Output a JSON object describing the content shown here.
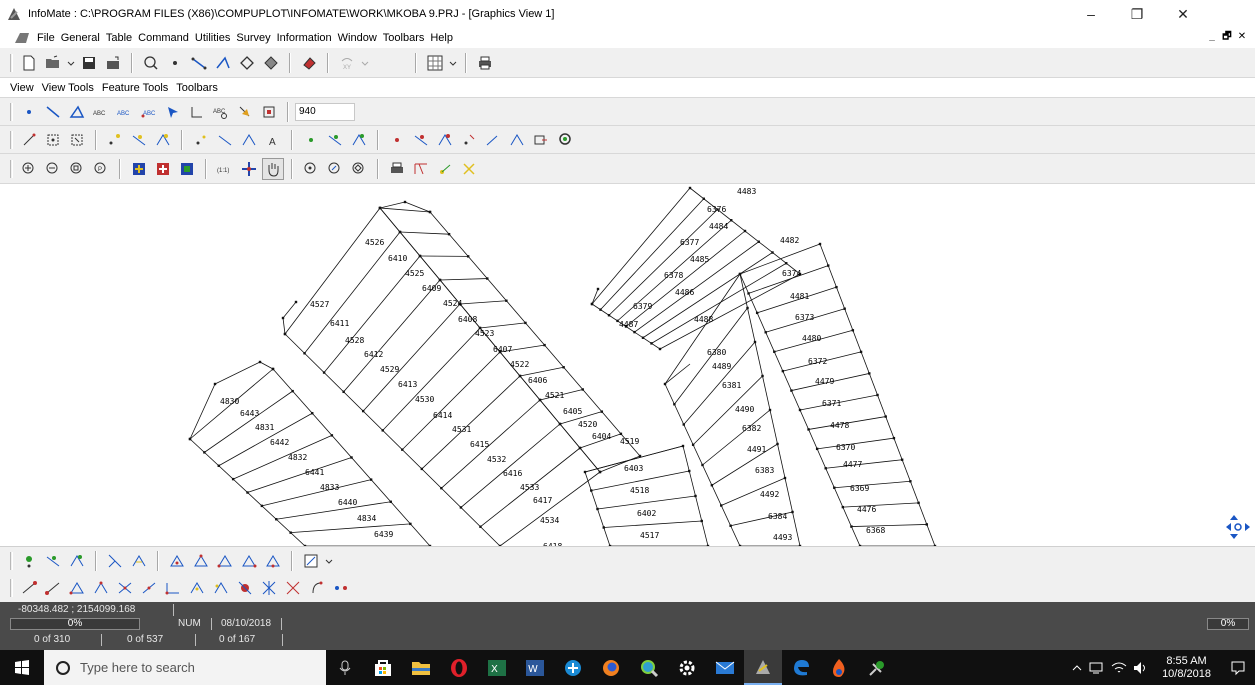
{
  "window": {
    "title": "InfoMate : C:\\PROGRAM FILES (X86)\\COMPUPLOT\\INFOMATE\\WORK\\MKOBA 9.PRJ - [Graphics View 1]",
    "minimize": "–",
    "restore": "❐",
    "close": "✕"
  },
  "menu": {
    "items": [
      "File",
      "General",
      "Table",
      "Command",
      "Utilities",
      "Survey",
      "Information",
      "Window",
      "Toolbars",
      "Help"
    ],
    "mdi": [
      "_",
      "🗗",
      "✕"
    ]
  },
  "view_menu": {
    "items": [
      "View",
      "View Tools",
      "Feature Tools",
      "Toolbars"
    ]
  },
  "toolbar": {
    "zoom_value": "940"
  },
  "parcels": {
    "labels": [
      "4483",
      "6376",
      "4484",
      "4482",
      "6377",
      "4485",
      "6374",
      "6378",
      "4486",
      "4481",
      "6379",
      "6373",
      "4487",
      "4488",
      "4480",
      "6380",
      "6372",
      "4489",
      "4479",
      "6381",
      "6371",
      "4490",
      "4478",
      "6382",
      "6370",
      "4491",
      "4477",
      "6383",
      "6369",
      "4492",
      "4476",
      "6384",
      "6368",
      "4493",
      "4526",
      "6410",
      "4525",
      "6409",
      "4524",
      "4527",
      "6408",
      "6411",
      "4523",
      "4528",
      "6407",
      "6412",
      "4522",
      "4529",
      "6406",
      "6413",
      "4521",
      "4530",
      "6405",
      "6414",
      "4520",
      "4531",
      "6404",
      "6415",
      "4519",
      "4532",
      "6403",
      "6416",
      "4518",
      "4533",
      "6417",
      "6402",
      "4534",
      "4517",
      "6418",
      "4830",
      "6443",
      "4831",
      "6442",
      "4832",
      "6441",
      "4833",
      "6440",
      "4834",
      "6439"
    ]
  },
  "status": {
    "coords": "-80348.482 ; 2154099.168",
    "progress_left": "0%",
    "num": "NUM",
    "date": "08/10/2018",
    "count1": "0 of 310",
    "count2": "0 of 537",
    "count3": "0 of 167",
    "progress_right": "0%"
  },
  "taskbar": {
    "search_placeholder": "Type here to search",
    "time": "8:55 AM",
    "date": "10/8/2018"
  },
  "colors": {
    "status_bg": "#4a4a4a",
    "taskbar_bg": "#101010",
    "toolbar_bg": "#f0f0f0"
  }
}
